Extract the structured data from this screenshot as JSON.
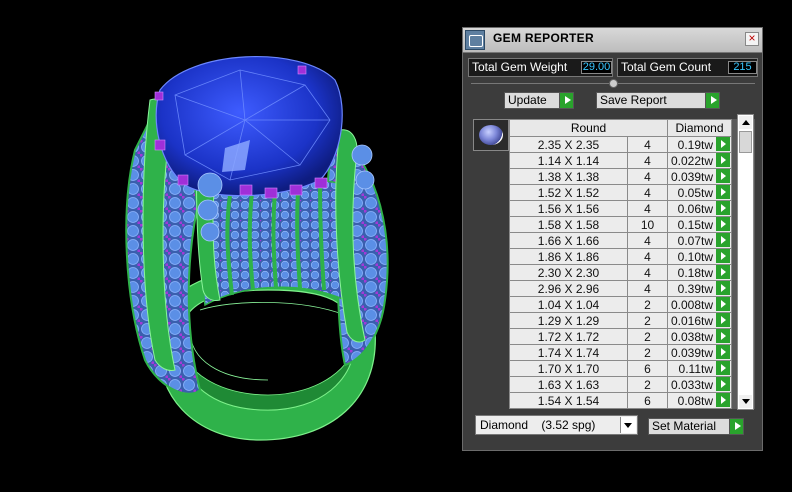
{
  "window": {
    "title": "GEM REPORTER",
    "close_glyph": "×"
  },
  "summary": {
    "weight_label": "Total Gem Weight",
    "weight_value": "29.00",
    "count_label": "Total Gem Count",
    "count_value": "215"
  },
  "buttons": {
    "update": "Update",
    "save_report": "Save Report",
    "set_material": "Set Material"
  },
  "table": {
    "headers": [
      "Round",
      "Diamond"
    ],
    "rows": [
      {
        "size": "2.35 X 2.35",
        "count": "4",
        "weight": "0.19tw"
      },
      {
        "size": "1.14 X 1.14",
        "count": "4",
        "weight": "0.022tw"
      },
      {
        "size": "1.38 X 1.38",
        "count": "4",
        "weight": "0.039tw"
      },
      {
        "size": "1.52 X 1.52",
        "count": "4",
        "weight": "0.05tw"
      },
      {
        "size": "1.56 X 1.56",
        "count": "4",
        "weight": "0.06tw"
      },
      {
        "size": "1.58 X 1.58",
        "count": "10",
        "weight": "0.15tw"
      },
      {
        "size": "1.66 X 1.66",
        "count": "4",
        "weight": "0.07tw"
      },
      {
        "size": "1.86 X 1.86",
        "count": "4",
        "weight": "0.10tw"
      },
      {
        "size": "2.30 X 2.30",
        "count": "4",
        "weight": "0.18tw"
      },
      {
        "size": "2.96 X 2.96",
        "count": "4",
        "weight": "0.39tw"
      },
      {
        "size": "1.04 X 1.04",
        "count": "2",
        "weight": "0.008tw"
      },
      {
        "size": "1.29 X 1.29",
        "count": "2",
        "weight": "0.016tw"
      },
      {
        "size": "1.72 X 1.72",
        "count": "2",
        "weight": "0.038tw"
      },
      {
        "size": "1.74 X 1.74",
        "count": "2",
        "weight": "0.039tw"
      },
      {
        "size": "1.70 X 1.70",
        "count": "6",
        "weight": "0.11tw"
      },
      {
        "size": "1.63 X 1.63",
        "count": "2",
        "weight": "0.033tw"
      },
      {
        "size": "1.54 X 1.54",
        "count": "6",
        "weight": "0.08tw"
      }
    ]
  },
  "material": {
    "selected": "Diamond    (3.52 spg)"
  },
  "viewport": {
    "model": "ring-3d-model",
    "colors": {
      "metal": "#2fb24a",
      "center_stone": "#1e3cc8",
      "accent_stones": "#4a86e0",
      "prongs": "#9a2fd0"
    }
  },
  "icons": {
    "app": "gem-reporter-icon",
    "close": "close-icon",
    "go": "green-arrow-icon",
    "gem": "round-gem-icon"
  }
}
